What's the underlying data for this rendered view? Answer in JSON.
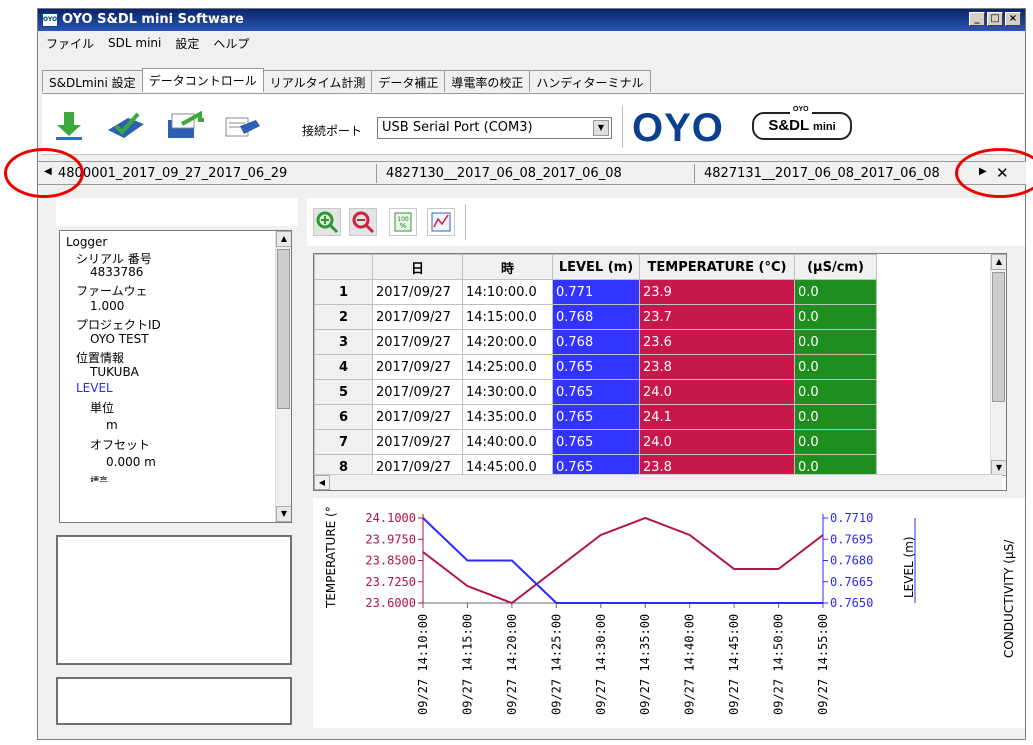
{
  "window": {
    "title": "OYO S&DL mini Software",
    "icon_text": "OYO",
    "minimize": "_",
    "maximize": "□",
    "close": "×"
  },
  "menu": [
    "ファイル",
    "SDL mini",
    "設定",
    "ヘルプ"
  ],
  "tabs": [
    "S&DLmini 設定",
    "データコントロール",
    "リアルタイム計測",
    "データ補正",
    "導電率の校正",
    "ハンディターミナル"
  ],
  "active_tab_index": 1,
  "toolbar": {
    "icons": [
      "download-icon",
      "check-send-icon",
      "file-transfer-icon",
      "edit-transfer-icon"
    ],
    "port_label": "接続ポート",
    "port_value": "USB Serial Port (COM3)",
    "logo_oyo": "OYO",
    "logo_sdl_top": "OYO",
    "logo_sdl_main": "S&DL",
    "logo_sdl_sub": "mini"
  },
  "file_tabs": [
    "4800001_2017_09_27_2017_06_29",
    "4827130__2017_06_08_2017_06_08",
    "4827131__2017_06_08_2017_06_08"
  ],
  "tree": [
    "Logger",
    "シリアル 番号",
    "4833786",
    "ファームウェ",
    "1.000",
    "プロジェクトID",
    "OYO TEST",
    "位置情報",
    "TUKUBA",
    "LEVEL",
    "単位",
    "m",
    "オフセット",
    "0.000 m",
    "標高"
  ],
  "grid_toolbar_icons": [
    "zoom-in-icon",
    "zoom-out-icon",
    "percent-100-icon",
    "chart-icon"
  ],
  "table": {
    "headers": [
      "日",
      "時",
      "LEVEL (m)",
      "TEMPERATURE (°C)",
      "(µS/cm)"
    ],
    "rows": [
      [
        "1",
        "2017/09/27",
        "14:10:00.0",
        "0.771",
        "23.9",
        "0.0"
      ],
      [
        "2",
        "2017/09/27",
        "14:15:00.0",
        "0.768",
        "23.7",
        "0.0"
      ],
      [
        "3",
        "2017/09/27",
        "14:20:00.0",
        "0.768",
        "23.6",
        "0.0"
      ],
      [
        "4",
        "2017/09/27",
        "14:25:00.0",
        "0.765",
        "23.8",
        "0.0"
      ],
      [
        "5",
        "2017/09/27",
        "14:30:00.0",
        "0.765",
        "24.0",
        "0.0"
      ],
      [
        "6",
        "2017/09/27",
        "14:35:00.0",
        "0.765",
        "24.1",
        "0.0"
      ],
      [
        "7",
        "2017/09/27",
        "14:40:00.0",
        "0.765",
        "24.0",
        "0.0"
      ],
      [
        "8",
        "2017/09/27",
        "14:45:00.0",
        "0.765",
        "23.8",
        "0.0"
      ]
    ]
  },
  "chart_data": {
    "type": "line",
    "x": [
      "09/27 14:10:00",
      "09/27 14:15:00",
      "09/27 14:20:00",
      "09/27 14:25:00",
      "09/27 14:30:00",
      "09/27 14:35:00",
      "09/27 14:40:00",
      "09/27 14:45:00",
      "09/27 14:50:00",
      "09/27 14:55:00"
    ],
    "left_axis": {
      "label": "TEMPERATURE (°",
      "ticks": [
        "24.1000",
        "23.9750",
        "23.8500",
        "23.7250",
        "23.6000"
      ],
      "range": [
        23.6,
        24.1
      ]
    },
    "right_axis": {
      "label": "LEVEL (m)",
      "ticks": [
        "0.7710",
        "0.7695",
        "0.7680",
        "0.7665",
        "0.7650"
      ],
      "range": [
        0.765,
        0.771
      ]
    },
    "far_right_label": "CONDUCTIVITY (µS/",
    "series": [
      {
        "name": "TEMPERATURE (°C)",
        "axis": "left",
        "color": "#b3124a",
        "values": [
          23.9,
          23.7,
          23.6,
          23.8,
          24.0,
          24.1,
          24.0,
          23.8,
          23.8,
          24.0
        ]
      },
      {
        "name": "LEVEL (m)",
        "axis": "right",
        "color": "#2a2aff",
        "values": [
          0.771,
          0.768,
          0.768,
          0.765,
          0.765,
          0.765,
          0.765,
          0.765,
          0.765,
          0.765
        ]
      }
    ],
    "grid": false
  }
}
